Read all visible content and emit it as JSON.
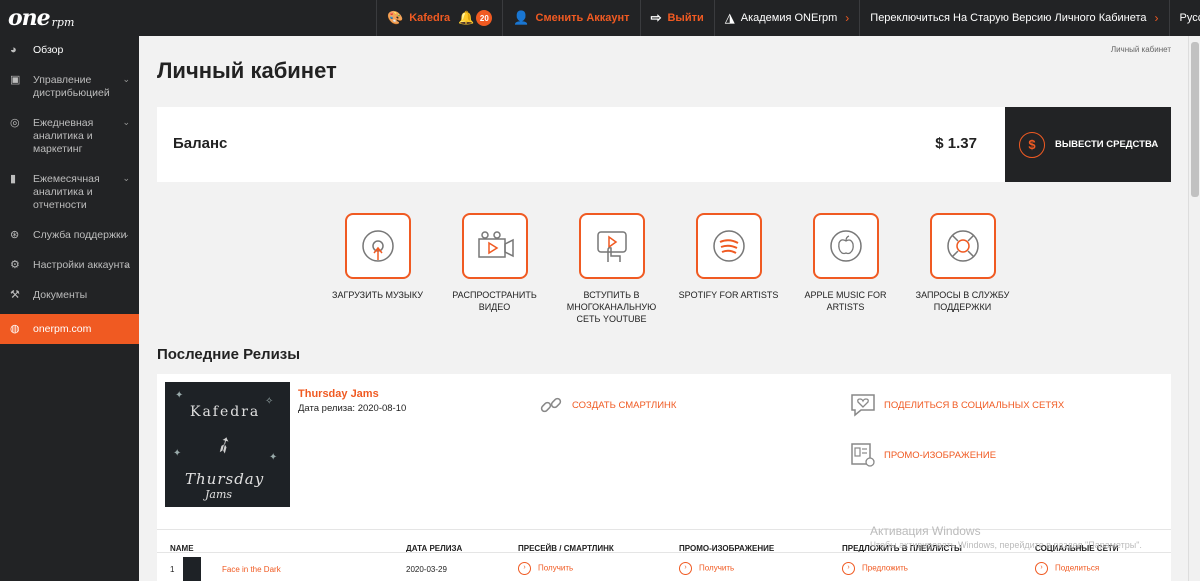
{
  "brand": {
    "logo_text": "one",
    "logo_suffix": "rpm"
  },
  "topnav": {
    "user": "Kafedra",
    "notifications": "20",
    "switch_account": "Сменить Аккаунт",
    "logout": "Выйти",
    "academy": "Академия ONErpm",
    "old_version": "Переключиться На Старую Версию Личного Кабинета",
    "language": "Русский"
  },
  "sidebar": {
    "items": [
      {
        "label": "Обзор"
      },
      {
        "label": "Управление дистрибьюцией"
      },
      {
        "label": "Ежедневная аналитика и маркетинг"
      },
      {
        "label": "Ежемесячная аналитика и отчетности"
      },
      {
        "label": "Служба поддержки"
      },
      {
        "label": "Настройки аккаунта"
      },
      {
        "label": "Документы"
      },
      {
        "label": "onerpm.com"
      }
    ]
  },
  "breadcrumb": "Личный кабинет",
  "page_title": "Личный кабинет",
  "balance": {
    "label": "Баланс",
    "value": "$ 1.37",
    "withdraw": "ВЫВЕСТИ СРЕДСТВА"
  },
  "actions": [
    {
      "label": "ЗАГРУЗИТЬ МУЗЫКУ"
    },
    {
      "label": "РАСПРОСТРАНИТЬ ВИДЕО"
    },
    {
      "label": "ВСТУПИТЬ В МНОГОКАНАЛЬНУЮ СЕТЬ YOUTUBE"
    },
    {
      "label": "SPOTIFY FOR ARTISTS"
    },
    {
      "label": "APPLE MUSIC FOR ARTISTS"
    },
    {
      "label": "ЗАПРОСЫ В СЛУЖБУ ПОДДЕРЖКИ"
    }
  ],
  "releases": {
    "heading": "Последние Релизы",
    "release": {
      "cover_line1": "Kafedra",
      "cover_line2": "Thursday",
      "cover_line3": "Jams",
      "title": "Thursday Jams",
      "date": "Дата релиза: 2020-08-10",
      "smartlink": "СОЗДАТЬ СМАРТЛИНК",
      "share": "ПОДЕЛИТЬСЯ В СОЦИАЛЬНЫХ СЕТЯХ",
      "promo": "ПРОМО-ИЗОБРАЖЕНИЕ"
    },
    "columns": [
      "NAME",
      "ДАТА РЕЛИЗА",
      "ПРЕСЕЙВ / СМАРТЛИНК",
      "ПРОМО-ИЗОБРАЖЕНИЕ",
      "ПРЕДЛОЖИТЬ В ПЛЕЙЛИСТЫ",
      "СОЦИАЛЬНЫЕ СЕТИ"
    ],
    "rows": [
      {
        "num": "1",
        "name": "Face in the Dark",
        "date": "2020-03-29",
        "presave": "Получить",
        "promo": "Получить",
        "playlist": "Предложить",
        "social": "Поделиться"
      }
    ]
  },
  "watermark": {
    "line1": "Активация Windows",
    "line2": "Чтобы активировать Windows, перейдите в раздел \"Параметры\"."
  },
  "colors": {
    "accent": "#f05a22",
    "dark": "#222325",
    "background": "#f2f2f2"
  }
}
